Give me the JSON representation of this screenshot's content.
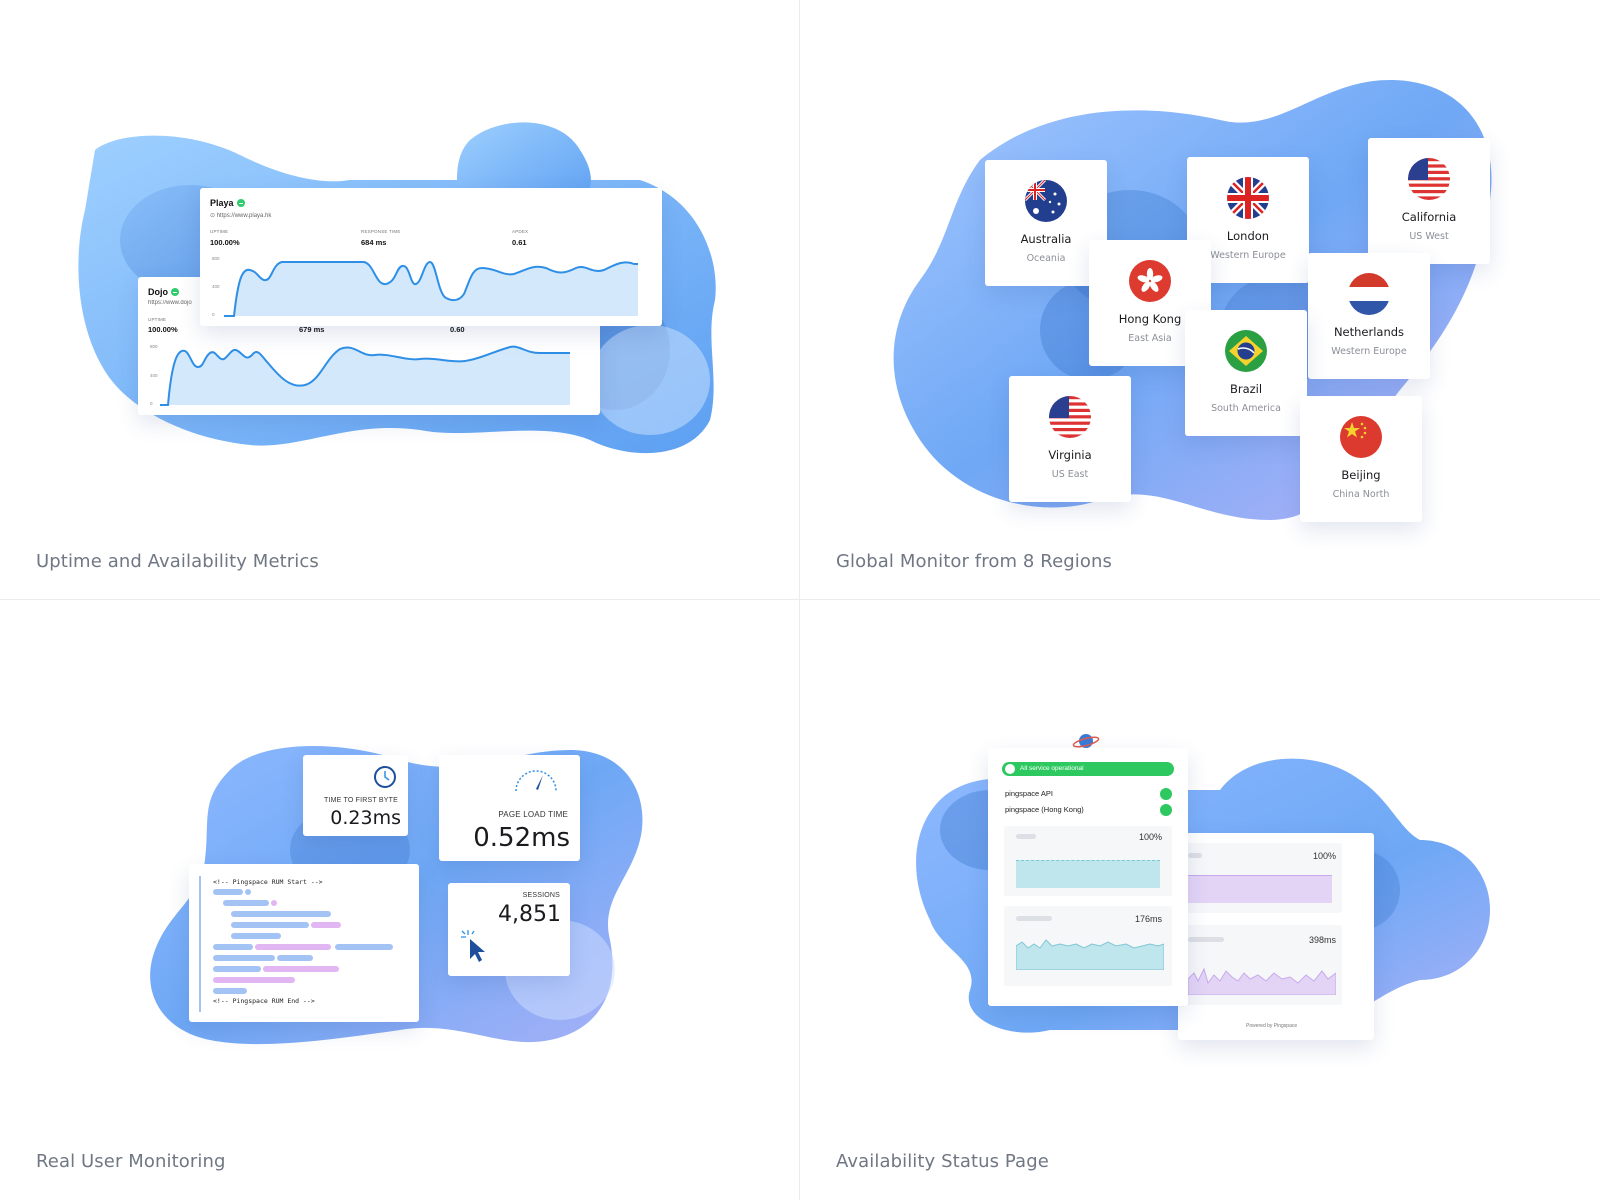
{
  "quadrants": {
    "uptime": {
      "caption": "Uptime and Availability Metrics",
      "card_front": {
        "name": "Playa",
        "url": "https://www.playa.hk",
        "labels": [
          "UPTIME",
          "RESPONSE TIME",
          "APDEX"
        ],
        "values": [
          "100.00%",
          "684 ms",
          "0.61"
        ],
        "ticks": [
          "800",
          "400",
          "0"
        ]
      },
      "card_back": {
        "name": "Dojo",
        "url": "https://www.dojo",
        "labels": [
          "UPTIME"
        ],
        "values": [
          "100.00%",
          "679 ms",
          "0.60"
        ],
        "ticks": [
          "800",
          "400",
          "0"
        ]
      }
    },
    "regions": {
      "caption": "Global Monitor from 8 Regions",
      "items": [
        {
          "city": "Australia",
          "area": "Oceania",
          "flag": "australia-flag-icon"
        },
        {
          "city": "London",
          "area": "Western Europe",
          "flag": "uk-flag-icon"
        },
        {
          "city": "California",
          "area": "US West",
          "flag": "usa-flag-icon"
        },
        {
          "city": "Hong Kong",
          "area": "East Asia",
          "flag": "hong-kong-flag-icon"
        },
        {
          "city": "Netherlands",
          "area": "Western Europe",
          "flag": "netherlands-flag-icon"
        },
        {
          "city": "Brazil",
          "area": "South America",
          "flag": "brazil-flag-icon"
        },
        {
          "city": "Virginia",
          "area": "US East",
          "flag": "usa-flag-icon"
        },
        {
          "city": "Beijing",
          "area": "China North",
          "flag": "china-flag-icon"
        }
      ]
    },
    "rum": {
      "caption": "Real User Monitoring",
      "ttfb": {
        "label": "TIME TO FIRST BYTE",
        "value": "0.23ms",
        "icon": "clock-icon"
      },
      "page_load": {
        "label": "PAGE LOAD TIME",
        "value": "0.52ms",
        "icon": "speedometer-icon"
      },
      "sessions": {
        "label": "SESSIONS",
        "value": "4,851",
        "icon": "cursor-click-icon"
      },
      "code": {
        "start": "<!-- Pingspace RUM Start -->",
        "end": "<!-- Pingspace RUM End -->"
      }
    },
    "status": {
      "caption": "Availability Status Page",
      "banner": "All service operational",
      "services": [
        "pingspace API",
        "pingspace (Hong Kong)"
      ],
      "front_metrics": [
        "100%",
        "176ms"
      ],
      "back_metrics": [
        "100%",
        "398ms"
      ],
      "powered": "Powered by Pingspace",
      "icon": "planet-icon"
    }
  },
  "colors": {
    "accent": "#2f8fe6",
    "green": "#2fcc6d",
    "purple": "#d9c6f2",
    "teal": "#bfe6ec"
  }
}
